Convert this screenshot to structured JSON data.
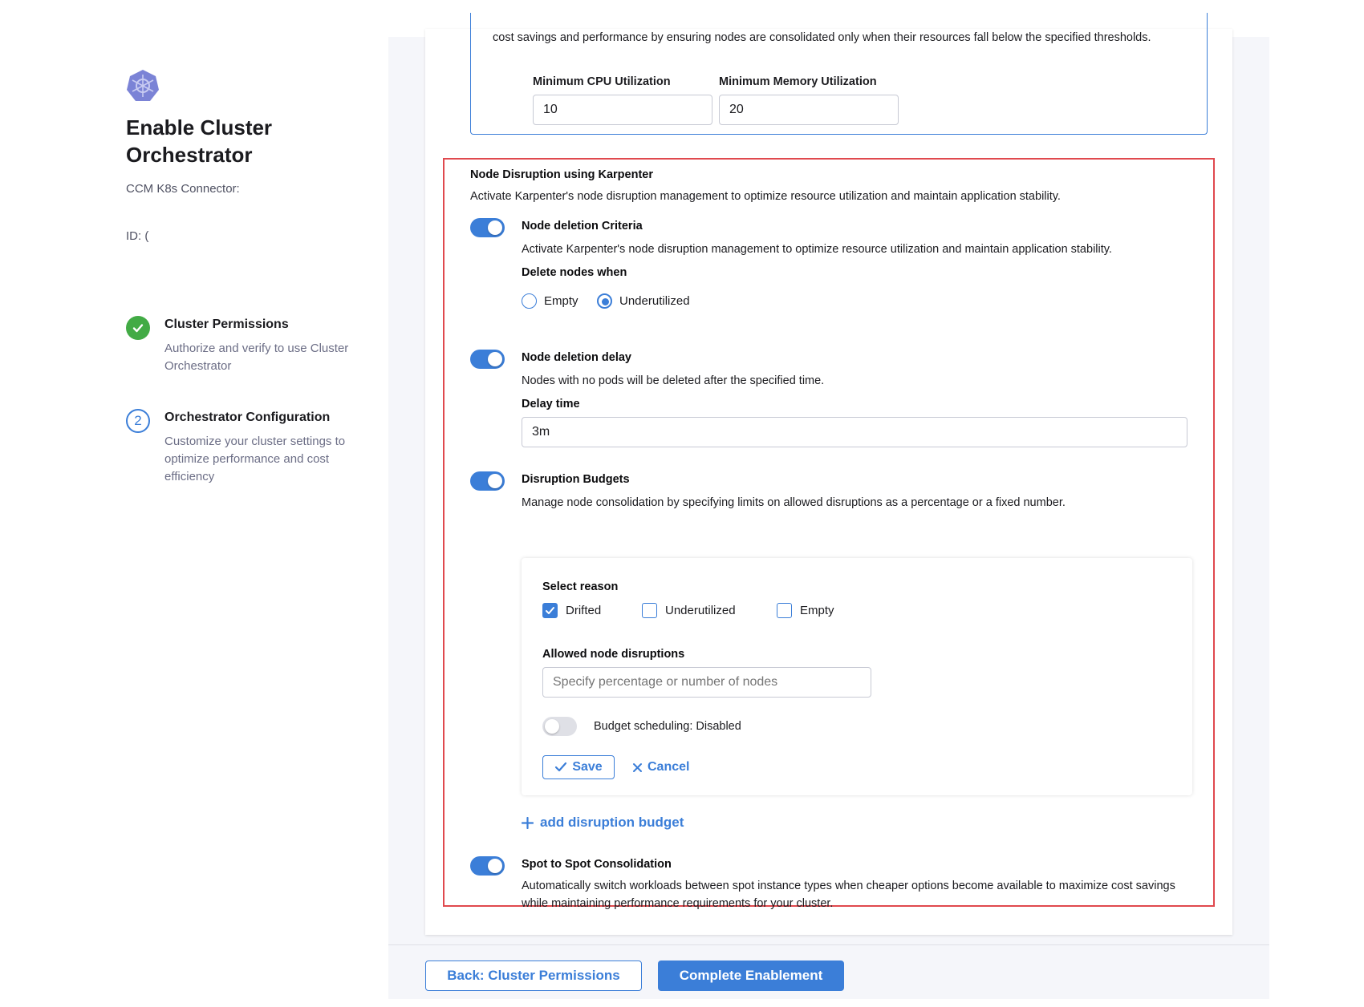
{
  "sidebar": {
    "title": "Enable Cluster Orchestrator",
    "connector_label": "CCM K8s Connector:",
    "id_label": "ID: (",
    "steps": [
      {
        "title": "Cluster Permissions",
        "description": "Authorize and verify to use Cluster Orchestrator",
        "status": "done"
      },
      {
        "number": "2",
        "title": "Orchestrator Configuration",
        "description": "Customize your cluster settings to optimize performance and cost efficiency",
        "status": "current"
      }
    ]
  },
  "consolidation": {
    "description": "cost savings and performance by ensuring nodes are consolidated only when their resources fall below the specified thresholds.",
    "cpu_label": "Minimum CPU Utilization",
    "cpu_value": "10",
    "memory_label": "Minimum Memory Utilization",
    "memory_value": "20"
  },
  "disruption": {
    "title": "Node Disruption using Karpenter",
    "description": "Activate Karpenter's node disruption management to optimize resource utilization and maintain application stability.",
    "deletion_criteria": {
      "enabled": true,
      "title": "Node deletion Criteria",
      "description": "Activate Karpenter's node disruption management to optimize resource utilization and maintain application stability.",
      "delete_when_label": "Delete nodes when",
      "options": [
        "Empty",
        "Underutilized"
      ],
      "selected": "Underutilized"
    },
    "deletion_delay": {
      "enabled": true,
      "title": "Node deletion delay",
      "description": "Nodes with no pods will be deleted after the specified time.",
      "delay_label": "Delay time",
      "delay_value": "3m"
    },
    "budgets": {
      "enabled": true,
      "title": "Disruption Budgets",
      "description": "Manage node consolidation by specifying limits on allowed disruptions as a percentage or a fixed number.",
      "reason_label": "Select reason",
      "reasons": [
        {
          "label": "Drifted",
          "checked": true
        },
        {
          "label": "Underutilized",
          "checked": false
        },
        {
          "label": "Empty",
          "checked": false
        }
      ],
      "allowed_label": "Allowed node disruptions",
      "allowed_placeholder": "Specify percentage or number of nodes",
      "scheduling_label": "Budget scheduling: Disabled",
      "scheduling_enabled": false,
      "save_label": "Save",
      "cancel_label": "Cancel",
      "add_label": "add disruption budget"
    },
    "spot": {
      "enabled": true,
      "title": "Spot to Spot Consolidation",
      "description": "Automatically switch workloads between spot instance types when cheaper options become available to maximize cost savings while maintaining performance requirements for your cluster."
    }
  },
  "footer": {
    "back_label": "Back: Cluster Permissions",
    "complete_label": "Complete Enablement"
  },
  "colors": {
    "accent": "#3b7ed8",
    "success": "#42ab45",
    "highlight_border": "#e0494e",
    "logo": "#7b83d6"
  }
}
